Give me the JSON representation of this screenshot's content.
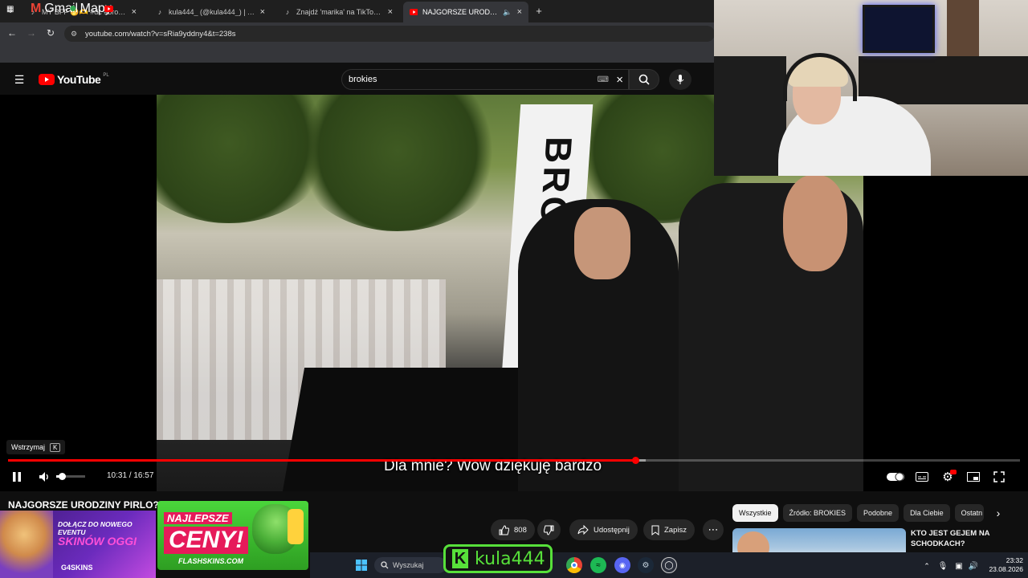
{
  "browser": {
    "tabs": [
      {
        "title": "MY BFF 🤭🫶 #dc #brokies #k",
        "favicon": "tiktok-icon"
      },
      {
        "title": "kula444_ (@kula444_) | TikTok",
        "favicon": "tiktok-icon"
      },
      {
        "title": "Znajdź 'marika' na TikTok | Wys",
        "favicon": "tiktok-icon"
      },
      {
        "title": "NAJGORSZE URODZINY PIR",
        "favicon": "youtube-icon",
        "active": true
      }
    ],
    "url": "youtube.com/watch?v=sRia9yddny4&t=238s",
    "bookmarks": [
      "Gmail",
      "Mapy"
    ]
  },
  "youtube": {
    "logo_text": "YouTube",
    "region": "PL",
    "search_value": "brokies"
  },
  "player": {
    "tooltip": "Wstrzymaj",
    "tooltip_key": "K",
    "caption": "Dla mnie? Wow dziękuję bardzo",
    "time": "10:31 / 16:57",
    "progress_fraction": 0.62,
    "buffered_fraction": 0.63,
    "volume_fraction": 0.2
  },
  "video": {
    "title": "NAJGORSZE URODZINY PIRLO?",
    "flag_text": "BROKIES",
    "likes": "808",
    "share_label": "Udostępnij",
    "save_label": "Zapisz"
  },
  "chips": [
    "Wszystkie",
    "Źródło: BROKIES",
    "Podobne",
    "Dla Ciebie",
    "Ostatn"
  ],
  "recommendation": {
    "title": "KTO JEST GEJEM NA SCHODKACH?"
  },
  "ads": {
    "ad1": {
      "line1": "DOŁĄCZ DO NOWEGO EVENTU",
      "line2": "SKINÓW OGGI",
      "brand": "G4SKINS"
    },
    "ad2": {
      "line1": "NAJLEPSZE",
      "line2": "CENY!",
      "brand": "FLASHSKINS.COM"
    }
  },
  "taskbar": {
    "search_placeholder": "Wyszukaj",
    "streamer_badge": "kula444",
    "streamer_badge_letter": "K",
    "time": "23:32",
    "date": "23.08.2026"
  },
  "colors": {
    "youtube_red": "#ff0000",
    "badge_green": "#57e03a",
    "background": "#0f0f0f"
  }
}
